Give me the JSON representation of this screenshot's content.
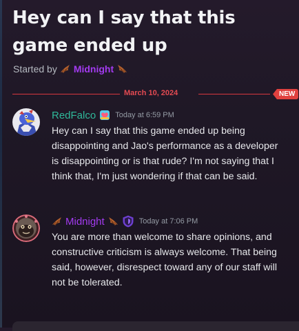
{
  "thread": {
    "title": "Hey can I say that this game ended up",
    "started_by_label": "Started by",
    "starter_name": "Midnight"
  },
  "divider": {
    "date": "March 10, 2024",
    "new_badge": "NEW"
  },
  "messages": [
    {
      "username": "RedFalco",
      "timestamp": "Today at 6:59 PM",
      "text": "Hey can I say that this game ended up being disappointing and Jao's performance as a developer is disappointing or is that rude? I'm not saying that I think that, I'm just wondering if that can be said."
    },
    {
      "username": "Midnight",
      "timestamp": "Today at 7:06 PM",
      "text": "You are more than welcome to share opinions, and constructive criticism is always welcome. That being said, however, disrespect toward any of our staff will not be tolerated."
    }
  ],
  "colors": {
    "background": "#1f1826",
    "accent_red": "#e0413f",
    "name_teal": "#2fb99a",
    "name_purple": "#a33bf0"
  },
  "icons": {
    "wing": "bat-wing-icon",
    "role_badge": "rainbow-heart-badge-icon",
    "moderator_shield": "shield-icon"
  }
}
